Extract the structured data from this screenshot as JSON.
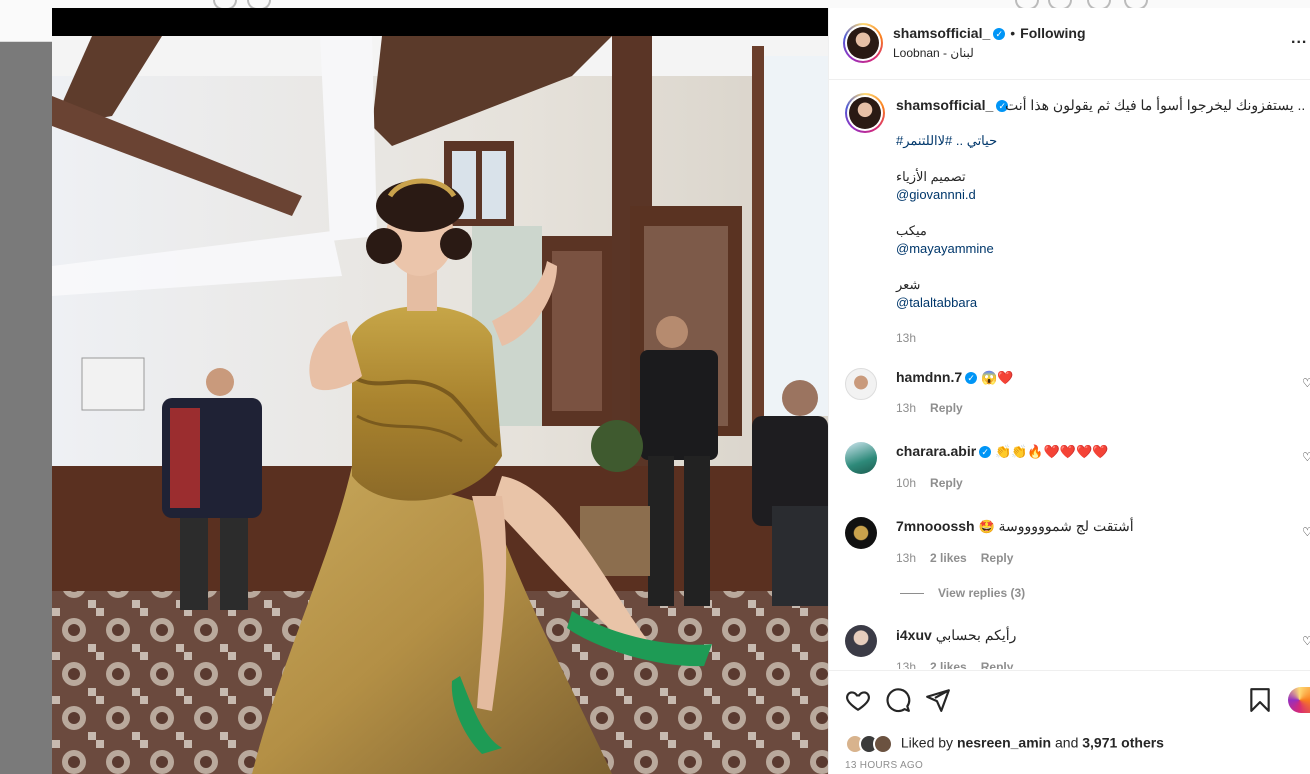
{
  "post": {
    "author": "shamsofficial_",
    "separator": "•",
    "follow_status": "Following",
    "location": "Loobnan - لبنان",
    "more_label": "...",
    "caption": {
      "author": "shamsofficial_",
      "text": ".. يستفزونك ليخرجوا أسوأ ما فيك ثم يقولون هذا أنت",
      "hashtags": "حياتي .. #لااللتنمر#",
      "fashion_label": "تصميم الأزياء",
      "fashion_handle": "@giovannni.d",
      "makeup_label": "ميكب",
      "makeup_handle": "@mayayammine",
      "hair_label": "شعر",
      "hair_handle": "@talaltabbara",
      "time": "13h"
    },
    "comments": [
      {
        "user": "hamdnn.7",
        "verified": true,
        "text": "",
        "emoji": "😱❤️",
        "time": "13h",
        "likes": "",
        "reply": "Reply"
      },
      {
        "user": "charara.abir",
        "verified": true,
        "text": "",
        "emoji": "👏👏🔥❤️❤️❤️❤️",
        "time": "10h",
        "likes": "",
        "reply": "Reply"
      },
      {
        "user": "7mnooossh",
        "verified": false,
        "text": "أشتقت لج شموووووسة",
        "emoji": "🤩",
        "time": "13h",
        "likes": "2 likes",
        "reply": "Reply"
      },
      {
        "user": "i4xuv",
        "verified": false,
        "text": "رأيكم بحسابي",
        "emoji": "",
        "time": "13h",
        "likes": "2 likes",
        "reply": "Reply"
      }
    ],
    "view_replies": "View replies (3)",
    "liked_by_prefix": "Liked by",
    "liked_by_user": "nesreen_amin",
    "liked_by_and": "and",
    "liked_by_others": "3,971 others",
    "post_time": "13 HOURS AGO"
  },
  "colors": {
    "accent": "#0095f6",
    "link": "#00376b",
    "muted": "#8e8e8e",
    "overlay": "#000000"
  },
  "icons": [
    "heart-icon",
    "comment-icon",
    "share-icon",
    "bookmark-icon",
    "verified-icon",
    "more-icon"
  ]
}
